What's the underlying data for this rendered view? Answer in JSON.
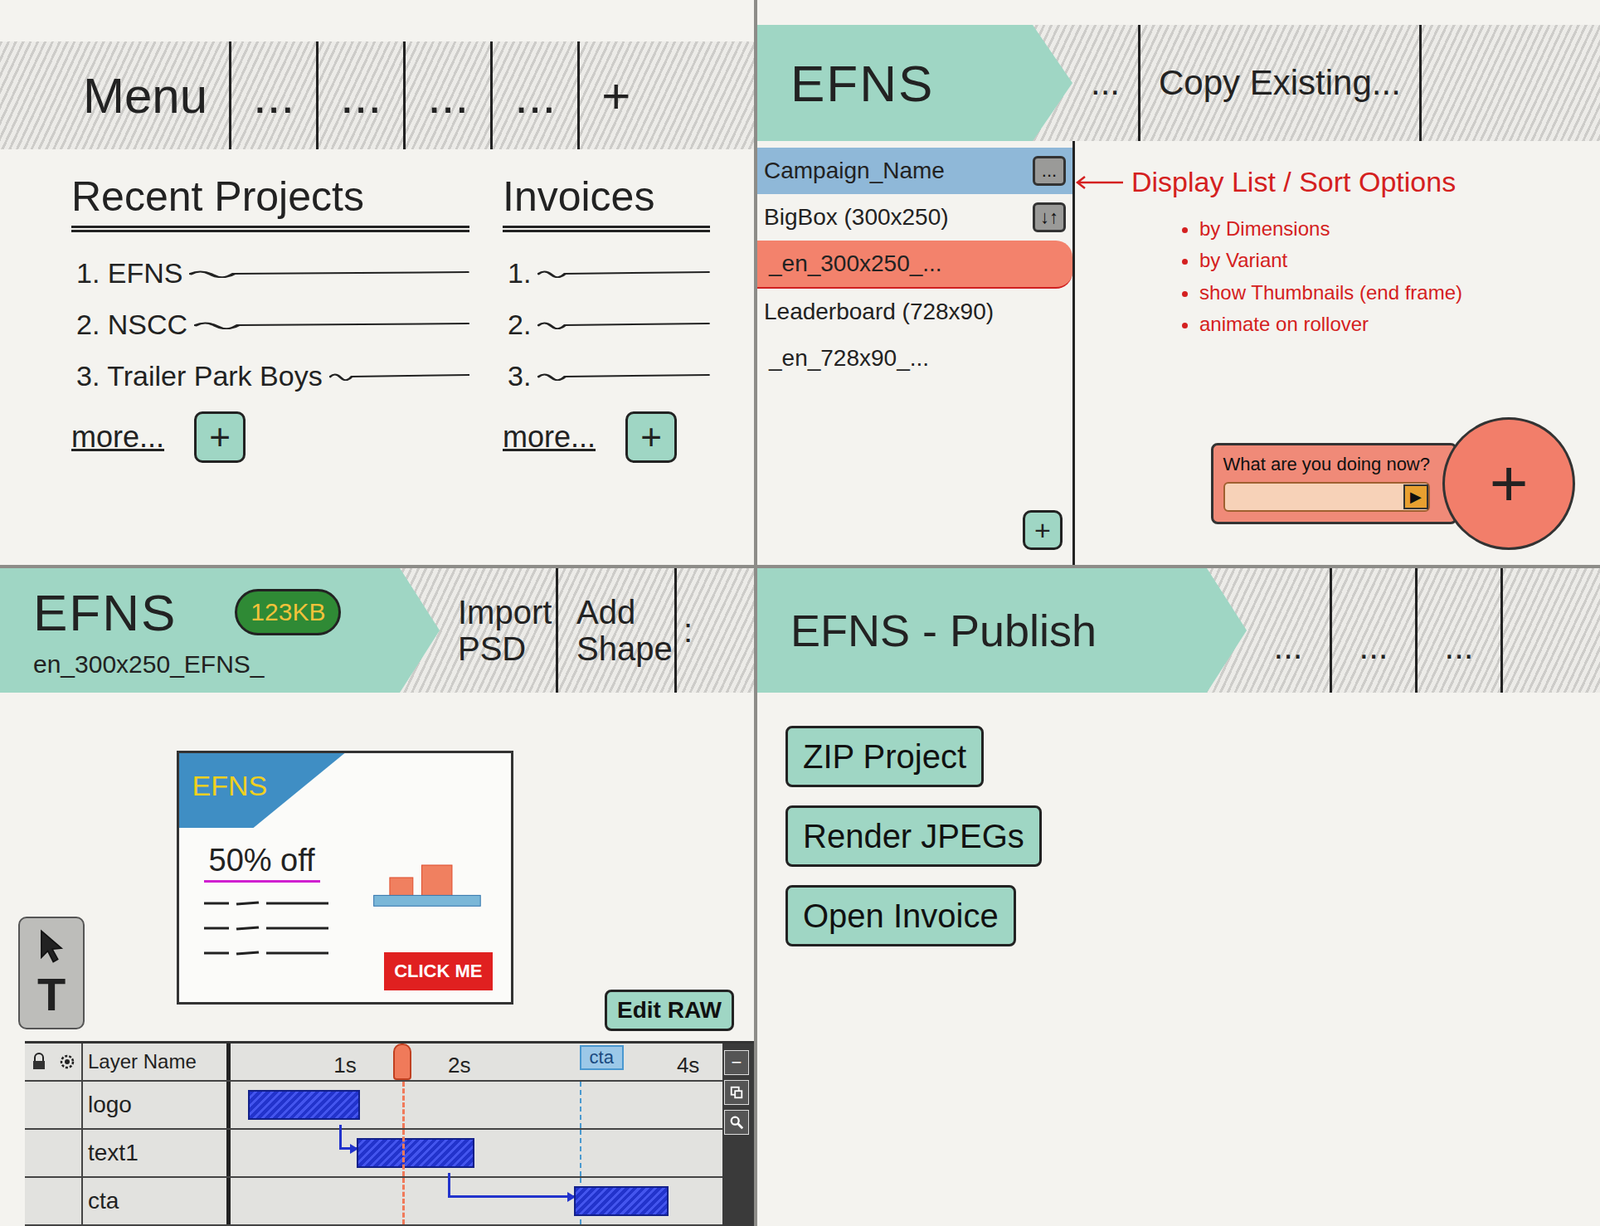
{
  "menu_screen": {
    "menu_bar": [
      "Menu",
      "...",
      "...",
      "...",
      "...",
      "+"
    ],
    "recent_projects": {
      "title": "Recent Projects",
      "items": [
        "1. EFNS",
        "2. NSCC",
        "3. Trailer Park Boys"
      ],
      "more": "more...",
      "add": "+"
    },
    "invoices": {
      "title": "Invoices",
      "items": [
        "1.",
        "2.",
        "3."
      ],
      "more": "more...",
      "add": "+"
    }
  },
  "campaign_screen": {
    "breadcrumb": "EFNS",
    "menu_items": [
      "...",
      "Copy Existing..."
    ],
    "display_list": {
      "header": "Campaign_Name",
      "header_button": "...",
      "items": [
        {
          "label": "BigBox (300x250)",
          "kind": "group",
          "selected": false,
          "button": "↓↑"
        },
        {
          "label": "_en_300x250_...",
          "kind": "variant",
          "selected": true
        },
        {
          "label": "Leaderboard (728x90)",
          "kind": "group",
          "selected": false
        },
        {
          "label": "_en_728x90_...",
          "kind": "variant",
          "selected": false
        }
      ],
      "add": "+"
    },
    "annotation": {
      "title": "Display List / Sort Options",
      "bullets": [
        "by Dimensions",
        "by Variant",
        "show Thumbnails (end frame)",
        "animate on rollover"
      ]
    },
    "quick_add": {
      "prompt": "What are you doing now?",
      "value": "",
      "submit": "▶",
      "add": "+"
    }
  },
  "editor_screen": {
    "breadcrumb": "EFNS",
    "size_badge": "123KB",
    "file": "en_300x250_EFNS_",
    "menu_items": [
      "Import PSD",
      "Add Shape",
      ":"
    ],
    "banner": {
      "logo": "EFNS",
      "headline": "50% off",
      "cta": "CLICK ME"
    },
    "text_tool": "T",
    "edit_raw": "Edit RAW",
    "timeline": {
      "layer_column": "Layer Name",
      "ticks": [
        {
          "label": "1s",
          "time": 1
        },
        {
          "label": "2s",
          "time": 2
        },
        {
          "label": "4s",
          "time": 4
        }
      ],
      "marker": {
        "label": "cta",
        "time": 3.05
      },
      "playhead": 1.5,
      "layers": [
        {
          "name": "logo",
          "start": 0.15,
          "end": 1.1,
          "linked": false
        },
        {
          "name": "text1",
          "start": 1.1,
          "end": 2.1,
          "linked": true
        },
        {
          "name": "cta",
          "start": 3.0,
          "end": 3.8,
          "linked": true
        }
      ],
      "zoom_out": "−"
    }
  },
  "publish_screen": {
    "breadcrumb": "EFNS - Publish",
    "menu_items": [
      "...",
      "...",
      "..."
    ],
    "buttons": [
      "ZIP Project",
      "Render JPEGs",
      "Open Invoice"
    ]
  }
}
